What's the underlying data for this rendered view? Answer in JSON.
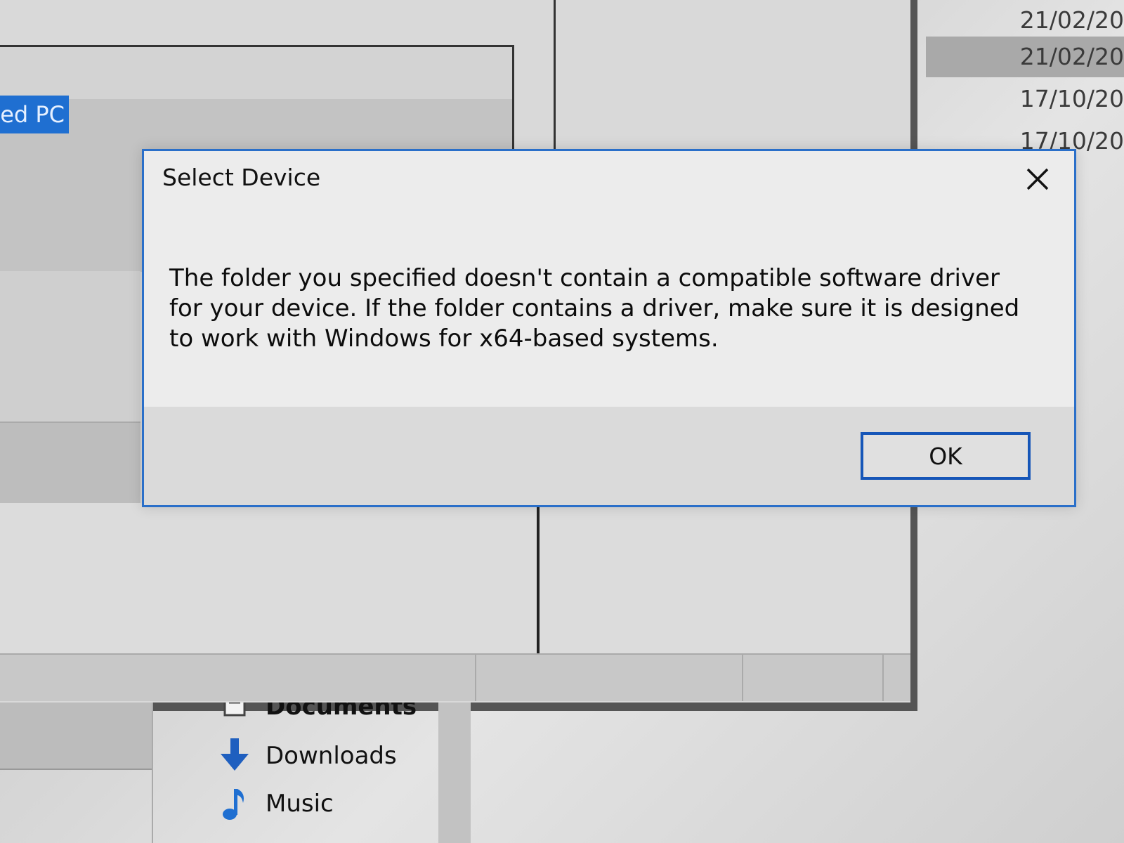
{
  "background": {
    "selected_item_text": "ed PC",
    "dates": [
      "21/02/20",
      "21/02/20",
      "17/10/20",
      "17/10/20"
    ],
    "nav_items": [
      {
        "label": "Documents",
        "icon": "documents-icon"
      },
      {
        "label": "Downloads",
        "icon": "downloads-icon"
      },
      {
        "label": "Music",
        "icon": "music-icon"
      }
    ]
  },
  "dialog": {
    "title": "Select Device",
    "message": "The folder you specified doesn't contain a compatible software driver for your device. If the folder contains a driver, make sure it is designed to work with Windows for x64-based systems.",
    "ok_label": "OK",
    "close_icon": "close-icon"
  },
  "colors": {
    "accent_blue": "#1656b8",
    "selection_blue": "#1f6fd1",
    "dialog_border": "#2a6fc9"
  }
}
